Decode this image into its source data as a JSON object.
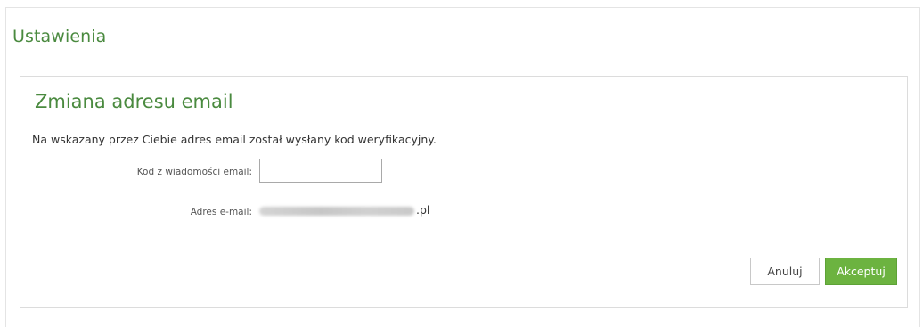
{
  "page": {
    "title": "Ustawienia"
  },
  "panel": {
    "title": "Zmiana adresu email",
    "info": "Na wskazany przez Ciebie adres email został wysłany kod weryfikacyjny."
  },
  "form": {
    "code_label": "Kod z wiadomości email:",
    "code_value": "",
    "email_label": "Adres e-mail:",
    "email_domain_suffix": ".pl"
  },
  "actions": {
    "cancel_label": "Anuluj",
    "accept_label": "Akceptuj"
  },
  "colors": {
    "accent_green": "#4a8a3f",
    "button_green": "#6cb340"
  }
}
